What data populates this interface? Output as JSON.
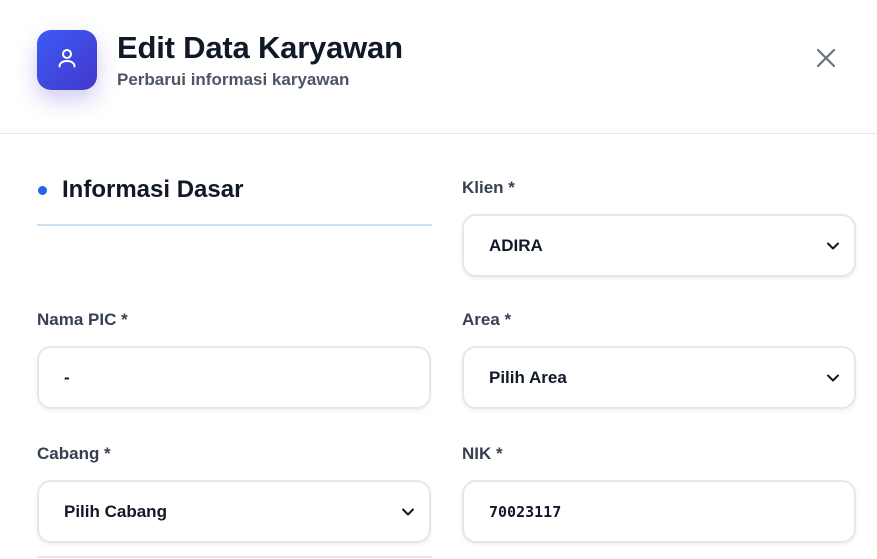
{
  "header": {
    "title": "Edit Data Karyawan",
    "subtitle": "Perbarui informasi karyawan",
    "avatar_icon": "user-icon",
    "close_icon": "close-icon"
  },
  "section": {
    "title": "Informasi Dasar"
  },
  "fields": {
    "klien": {
      "label": "Klien *",
      "value": "ADIRA"
    },
    "nama_pic": {
      "label": "Nama PIC *",
      "value": "-"
    },
    "area": {
      "label": "Area *",
      "value": "Pilih Area"
    },
    "cabang": {
      "label": "Cabang *",
      "value": "Pilih Cabang"
    },
    "nik": {
      "label": "NIK *",
      "value": "70023117"
    }
  },
  "colors": {
    "accent": "#2563eb",
    "avatar_gradient_start": "#3b5bf6",
    "avatar_gradient_end": "#4338ca"
  }
}
